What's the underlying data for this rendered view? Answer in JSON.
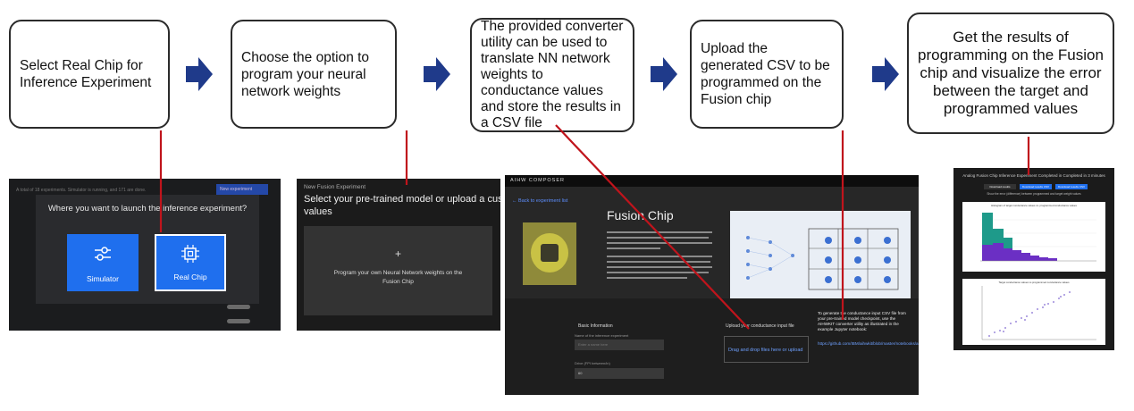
{
  "steps": [
    {
      "text": "Select Real Chip for Inference Experiment"
    },
    {
      "text": "Choose the option to program your neural network weights"
    },
    {
      "text": "The provided converter utility can be used to translate NN network weights to conductance values and store the results in a CSV file"
    },
    {
      "text": "Upload the generated CSV to be programmed on the Fusion chip"
    },
    {
      "text": "Get the results of programming on the Fusion chip and visualize the error between the target and programmed values"
    }
  ],
  "colors": {
    "arrow": "#1f3a8a",
    "connector": "#c0141c",
    "accent_blue": "#1f6fee"
  },
  "shot1": {
    "topbar": "A total of 18 experiments. Simulator is running, and 171 are done.",
    "new_button": "New experiment",
    "modal_title": "Where you want to launch the inference experiment?",
    "simulator_label": "Simulator",
    "realchip_label": "Real Chip",
    "simulator_icon": "sliders-icon",
    "realchip_icon": "chip-icon"
  },
  "shot2": {
    "crumb": "New Fusion Experiment",
    "heading": "Select your pre-trained model or upload a custom values",
    "plus": "+",
    "panel_text": "Program your own Neural Network weights on the Fusion Chip"
  },
  "shot3": {
    "topbar": "AIHW COMPOSER",
    "back_link": "← Back to experiment list",
    "title": "Fusion Chip",
    "basic_info": "Basic Information",
    "name_label": "Name of the inference experiment",
    "name_placeholder": "Enter a name here",
    "drift_label": "Drive (FPI between/in)",
    "drift_value": "60",
    "upload_label": "Upload your conductance input file",
    "drop_text": "Drag and drop files here or upload",
    "note_text": "To generate the conductance input CSV file from your pre-trained model checkpoint, use the AIHWKIT converter utility as illustrated in the example Jupyter notebook:",
    "note_link": "https://github.com/IBM/aihwkit/blob/master/notebooks/analog_fusion.ipynb"
  },
  "shot4": {
    "title": "Analog Fusion Chip Inference Experiment Completed in Completed in 3 minutes",
    "btn1": "Download results",
    "btn2": "Download results CSV",
    "btn3": "Download results CSV",
    "subtitle": "Show the error (difference) between programmed and target weight values",
    "chart1_title": "Histogram of target conductance values vs. programmed conductance values",
    "chart2_title": "Target conductance values vs programmed conductance values"
  }
}
